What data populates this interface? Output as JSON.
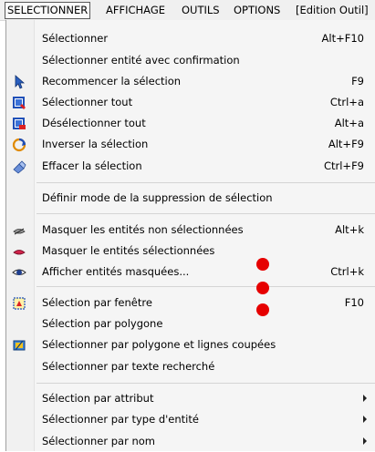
{
  "menubar": {
    "items": [
      {
        "label": "SELECTIONNER",
        "active": true
      },
      {
        "label": "AFFICHAGE"
      },
      {
        "label": "OUTILS"
      },
      {
        "label": "OPTIONS"
      },
      {
        "label": "[Edition Outil]"
      }
    ]
  },
  "menu": {
    "items": [
      {
        "label": "Sélectionner",
        "shortcut": "Alt+F10"
      },
      {
        "label": "Sélectionner entité avec confirmation",
        "shortcut": ""
      },
      {
        "label": "Recommencer la sélection",
        "shortcut": "F9",
        "icon": "cursor-arrow-icon"
      },
      {
        "label": "Sélectionner tout",
        "shortcut": "Ctrl+a",
        "icon": "select-all-icon"
      },
      {
        "label": "Désélectionner tout",
        "shortcut": "Alt+a",
        "icon": "deselect-all-icon"
      },
      {
        "label": "Inverser la sélection",
        "shortcut": "Alt+F9",
        "icon": "invert-selection-icon"
      },
      {
        "label": "Effacer la sélection",
        "shortcut": "Ctrl+F9",
        "icon": "eraser-icon"
      },
      {
        "label": "Définir mode de la suppression de sélection",
        "shortcut": ""
      },
      {
        "label": "Masquer les entités non sélectionnées",
        "shortcut": "Alt+k",
        "icon": "hide-unselected-icon"
      },
      {
        "label": "Masquer le entités sélectionnées",
        "shortcut": "",
        "icon": "hide-selected-icon"
      },
      {
        "label": "Afficher entités masquées...",
        "shortcut": "Ctrl+k",
        "icon": "show-hidden-icon"
      },
      {
        "label": "Sélection par fenêtre",
        "shortcut": "F10",
        "icon": "window-selection-icon"
      },
      {
        "label": "Sélection par polygone",
        "shortcut": ""
      },
      {
        "label": "Sélectionner par polygone et lignes coupées",
        "shortcut": "",
        "icon": "polygon-cut-icon"
      },
      {
        "label": "Sélectionner par texte recherché",
        "shortcut": ""
      },
      {
        "label": "Sélection par attribut",
        "submenu": true
      },
      {
        "label": "Sélectionner par type d'entité",
        "submenu": true
      },
      {
        "label": "Sélectionner par nom",
        "submenu": true
      }
    ]
  },
  "annotations": {
    "dot_color": "#e60000"
  }
}
